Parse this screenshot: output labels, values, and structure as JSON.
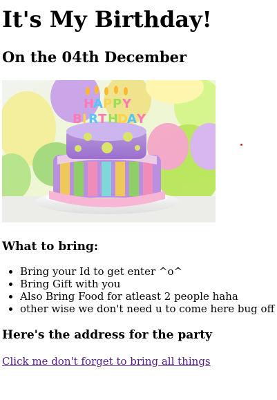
{
  "title": "It's My Birthday!",
  "date_heading": "On the 04th December",
  "hero_image": {
    "icon": "birthday-cake-image",
    "topper_text": [
      "HAPPY",
      "BIRTHDAY"
    ],
    "colors": {
      "plate": "#f4f4f4",
      "frosting_top": "#b087d2",
      "frosting_bottom": "#9a72c6",
      "ribbon": "#f3a9c8",
      "dots": "#c7de53"
    }
  },
  "bring_heading": "What to bring:",
  "bring_items": [
    "Bring your Id to get enter ^o^",
    "Bring Gift with you",
    "Also Bring Food for atleast 2 people haha",
    "other wise we don't need u to come here bug off"
  ],
  "address_heading": "Here's the address for the party",
  "address_link": "Click me don't forget to bring all things",
  "link_color": "#551a8b"
}
